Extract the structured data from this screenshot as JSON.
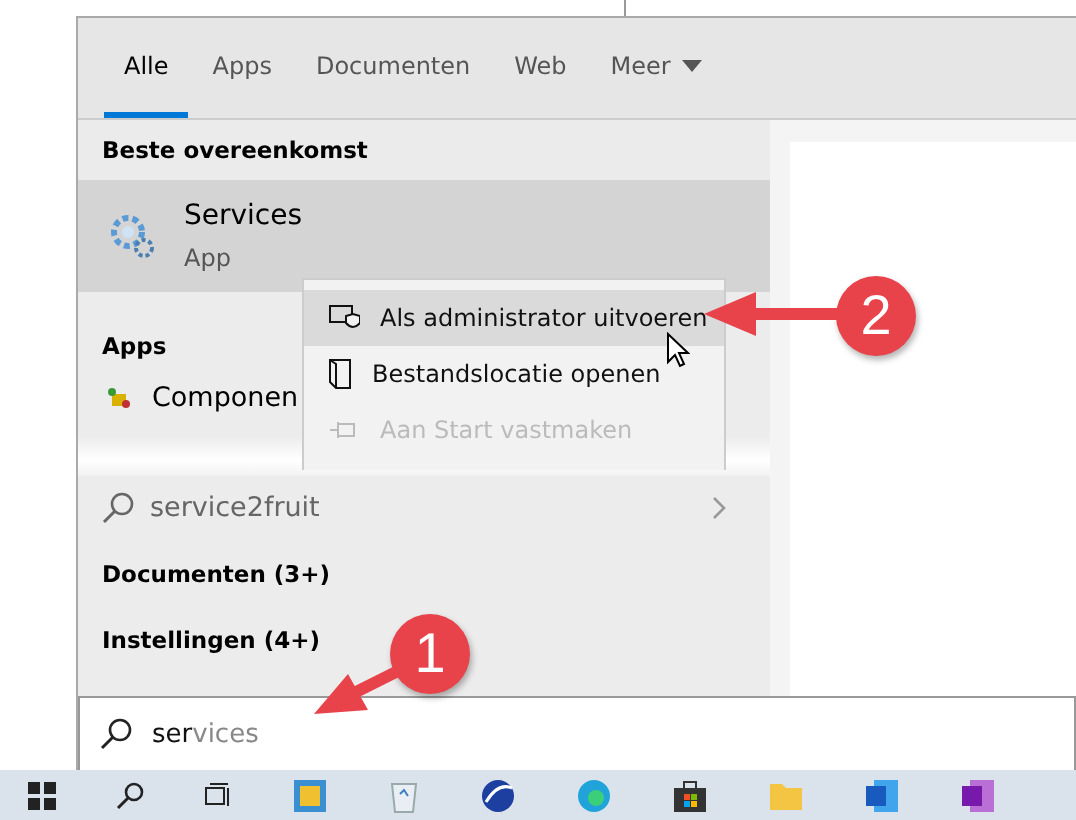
{
  "tabs": [
    {
      "label": "Alle",
      "selected": true
    },
    {
      "label": "Apps",
      "selected": false
    },
    {
      "label": "Documenten",
      "selected": false
    },
    {
      "label": "Web",
      "selected": false
    },
    {
      "label": "Meer",
      "selected": false,
      "dropdown": true
    }
  ],
  "best_match": {
    "header": "Beste overeenkomst",
    "title": "Services",
    "subtitle": "App"
  },
  "apps": {
    "header": "Apps",
    "items": [
      {
        "label": "Componen"
      }
    ]
  },
  "web_suggestion": {
    "label": "service2fruit"
  },
  "categories": [
    {
      "label": "Documenten (3+)"
    },
    {
      "label": "Instellingen (4+)"
    }
  ],
  "context_menu": [
    {
      "label": "Als administrator uitvoeren",
      "selected": true,
      "faded": false
    },
    {
      "label": "Bestandslocatie openen",
      "selected": false,
      "faded": false
    },
    {
      "label": "Aan Start vastmaken",
      "selected": false,
      "faded": true
    }
  ],
  "search": {
    "typed": "ser",
    "completion": "vices"
  },
  "callouts": [
    {
      "number": "1"
    },
    {
      "number": "2"
    }
  ]
}
